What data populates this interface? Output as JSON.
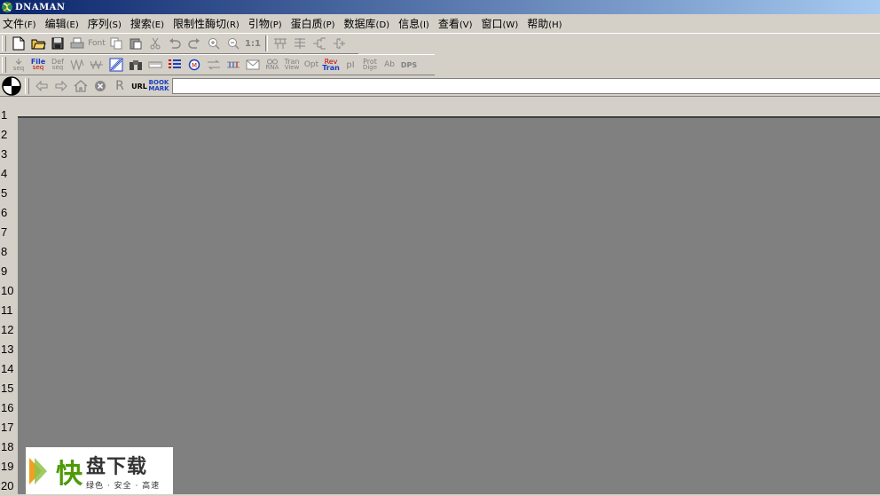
{
  "window": {
    "title": "DNAMAN",
    "icon": "dna-app-icon"
  },
  "menu": [
    {
      "label": "文件",
      "acc": "(F)"
    },
    {
      "label": "编辑",
      "acc": "(E)"
    },
    {
      "label": "序列",
      "acc": "(S)"
    },
    {
      "label": "搜索",
      "acc": "(E)"
    },
    {
      "label": "限制性酶切",
      "acc": "(R)"
    },
    {
      "label": "引物",
      "acc": "(P)"
    },
    {
      "label": "蛋白质",
      "acc": "(P)"
    },
    {
      "label": "数据库",
      "acc": "(D)"
    },
    {
      "label": "信息",
      "acc": "(I)"
    },
    {
      "label": "查看",
      "acc": "(V)"
    },
    {
      "label": "窗口",
      "acc": "(W)"
    },
    {
      "label": "帮助",
      "acc": "(H)"
    }
  ],
  "toolbar1": {
    "font_label": "Font",
    "zoom_one_label": "1:1"
  },
  "toolbar2": {
    "seq_label": "seq",
    "file_seq": [
      "File",
      "seq"
    ],
    "def_seq": [
      "Def",
      "seq"
    ],
    "rna_label": "RNA",
    "tran_view": [
      "Tran",
      "View"
    ],
    "opt_label": "Opt",
    "rev_tran": [
      "Rev",
      "Tran"
    ],
    "pi_label": "pI",
    "prot_dige": [
      "Prot",
      "Dige"
    ],
    "ab_label": "Ab",
    "dps_label": "DPS"
  },
  "urlbar": {
    "r_label": "R",
    "url_label": "URL",
    "bookmark": [
      "BOOK",
      "MARK"
    ],
    "url_value": ""
  },
  "line_numbers": [
    "1",
    "2",
    "3",
    "4",
    "5",
    "6",
    "7",
    "8",
    "9",
    "10",
    "11",
    "12",
    "13",
    "14",
    "15",
    "16",
    "17",
    "18",
    "19",
    "20"
  ],
  "watermark": {
    "big_char": "快",
    "title": "盘下载",
    "subtitle": "绿色 · 安全 · 高速"
  },
  "colors": {
    "titlebar_start": "#0a246a",
    "workspace": "#808080",
    "chrome": "#d4d0c8",
    "watermark_green": "#4e9a06"
  }
}
